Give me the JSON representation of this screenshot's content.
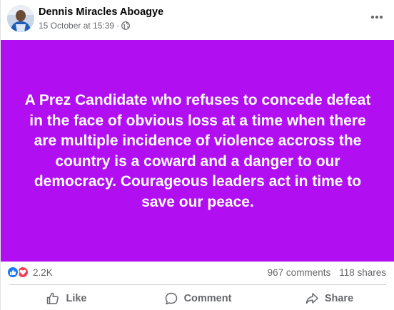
{
  "post": {
    "author": "Dennis Miracles Aboagye",
    "timestamp": "15 October at 15:39",
    "separator": "·",
    "privacy_icon": "globe-icon",
    "more_icon": "more-options-icon",
    "background_color": "#b10ff2",
    "text": "A Prez Candidate who refuses to concede defeat in the face of obvious loss at a time when there are multiple incidence of violence accross the country is a coward and a danger to our democracy. Courageous leaders act in time to save our peace."
  },
  "stats": {
    "reaction_icons": [
      "like-reaction-icon",
      "love-reaction-icon"
    ],
    "reaction_count": "2.2K",
    "comments": "967 comments",
    "shares": "118 shares"
  },
  "actions": {
    "like_label": "Like",
    "comment_label": "Comment",
    "share_label": "Share"
  },
  "colors": {
    "like_blue": "#1877f2",
    "love_red": "#f33e58",
    "secondary_text": "#65676b"
  }
}
